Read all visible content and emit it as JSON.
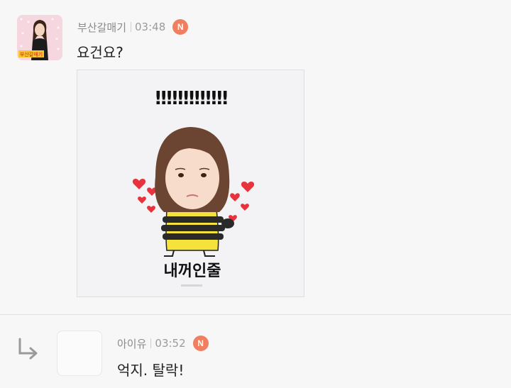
{
  "comments": [
    {
      "nickname": "부산갈매기",
      "time": "03:48",
      "badge": "N",
      "text": "요건요?",
      "avatar_caption": "부산갈매기",
      "sticker": {
        "top_text": "!!!!!!!!!!!!!",
        "caption": "내꺼인줄"
      }
    },
    {
      "nickname": "아이유",
      "time": "03:52",
      "badge": "N",
      "text": "억지. 탈락!"
    }
  ],
  "colors": {
    "background": "#f7f7f7",
    "badge": "#f07f5f",
    "heart": "#e8323c",
    "sticker_shirt": "#f5e33c"
  },
  "icons": [
    "reply-arrow-icon",
    "new-badge"
  ]
}
